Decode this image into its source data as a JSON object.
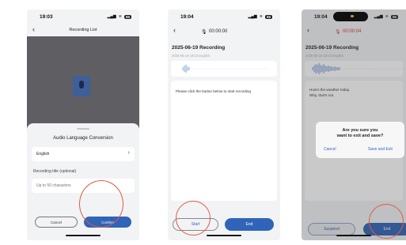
{
  "phone1": {
    "time": "19:03",
    "title": "Recording List",
    "sheet_title": "Audio Language Conversion",
    "language": "English",
    "title_label": "Recording title (optional)",
    "title_placeholder": "Up to 50 characters",
    "cancel_label": "Cancel",
    "confirm_label": "Confirm"
  },
  "phone2": {
    "time": "19:04",
    "timer": "00:00:00",
    "rec_title": "2025-06-19  Recording",
    "rec_meta": "2025-06-19 19:03  English",
    "hint": "Please click the button below to start recording",
    "start_label": "Start",
    "end_label": "End"
  },
  "phone3": {
    "time": "19:04",
    "timer": "00:00:04",
    "rec_title": "2025-06-19  Recording",
    "rec_meta": "2025-06-19 19:03  English",
    "transcript_line1": "How's the weather today.",
    "transcript_line2": "Why, that's not.",
    "dialog_title_line1": "Are you sure you",
    "dialog_title_line2": "want to exit and save?",
    "dialog_cancel": "Cancel",
    "dialog_save": "Save and Exit",
    "suspend_label": "Suspend",
    "end_label": "End"
  },
  "status": {
    "signal": "📶",
    "wifi": "wifi",
    "battery": "65"
  },
  "colors": {
    "accent": "#2f64b8",
    "recording_red": "#d7333a",
    "annotation": "#e05a48"
  }
}
